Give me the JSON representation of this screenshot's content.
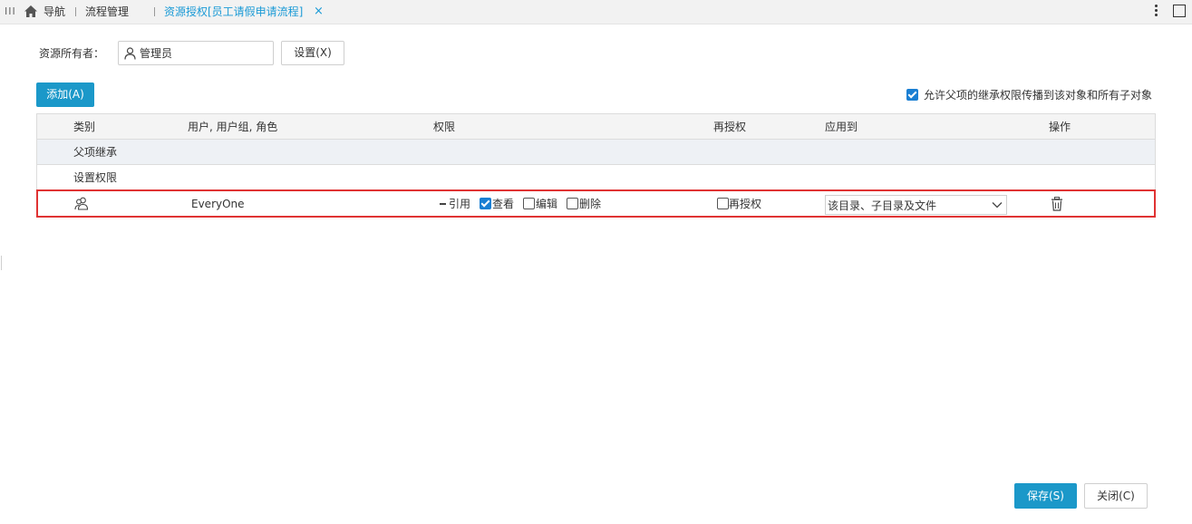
{
  "tabbar": {
    "menu_icon": "III",
    "nav_label": "导航",
    "flow_label": "流程管理",
    "active_tab": "资源授权[员工请假申请流程]",
    "close_glyph": "×"
  },
  "owner": {
    "label": "资源所有者：",
    "value": "管理员",
    "set_button": "设置(X)"
  },
  "toolbar": {
    "add_button": "添加(A)",
    "inherit_label": "允许父项的继承权限传播到该对象和所有子对象",
    "inherit_checked": true
  },
  "table": {
    "headers": {
      "type": "类别",
      "users": "用户, 用户组, 角色",
      "permission": "权限",
      "regrant": "再授权",
      "apply_to": "应用到",
      "action": "操作"
    },
    "groups": {
      "inherited": "父项继承",
      "set_permissions": "设置权限"
    },
    "rows": [
      {
        "type_icon": "user-group-icon",
        "user": "EveryOne",
        "quote": "引用",
        "view": "查看",
        "view_checked": true,
        "edit": "编辑",
        "edit_checked": false,
        "delete": "删除",
        "delete_checked": false,
        "regrant": "再授权",
        "regrant_checked": false,
        "apply_to": "该目录、子目录及文件",
        "action_icon": "trash-icon"
      }
    ]
  },
  "footer": {
    "save_button": "保存(S)",
    "close_button": "关闭(C)"
  },
  "colors": {
    "accent": "#1b98c9",
    "active_tab": "#1a9ad6",
    "highlight_border": "#e03333"
  }
}
